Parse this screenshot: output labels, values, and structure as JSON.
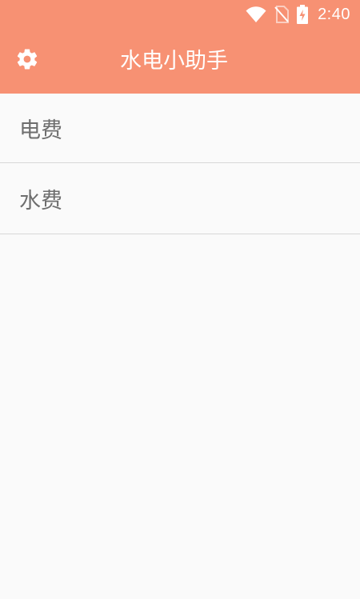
{
  "status_bar": {
    "time": "2:40",
    "icons": [
      "wifi-icon",
      "no-sim-icon",
      "battery-charging-icon"
    ]
  },
  "app_bar": {
    "title": "水电小助手",
    "settings_icon": "gear-icon"
  },
  "list": {
    "items": [
      {
        "label": "电费"
      },
      {
        "label": "水费"
      }
    ]
  },
  "colors": {
    "accent": "#f79173",
    "background": "#fafafa",
    "item_text": "#6e6e6e",
    "divider": "#d7d7d7"
  }
}
